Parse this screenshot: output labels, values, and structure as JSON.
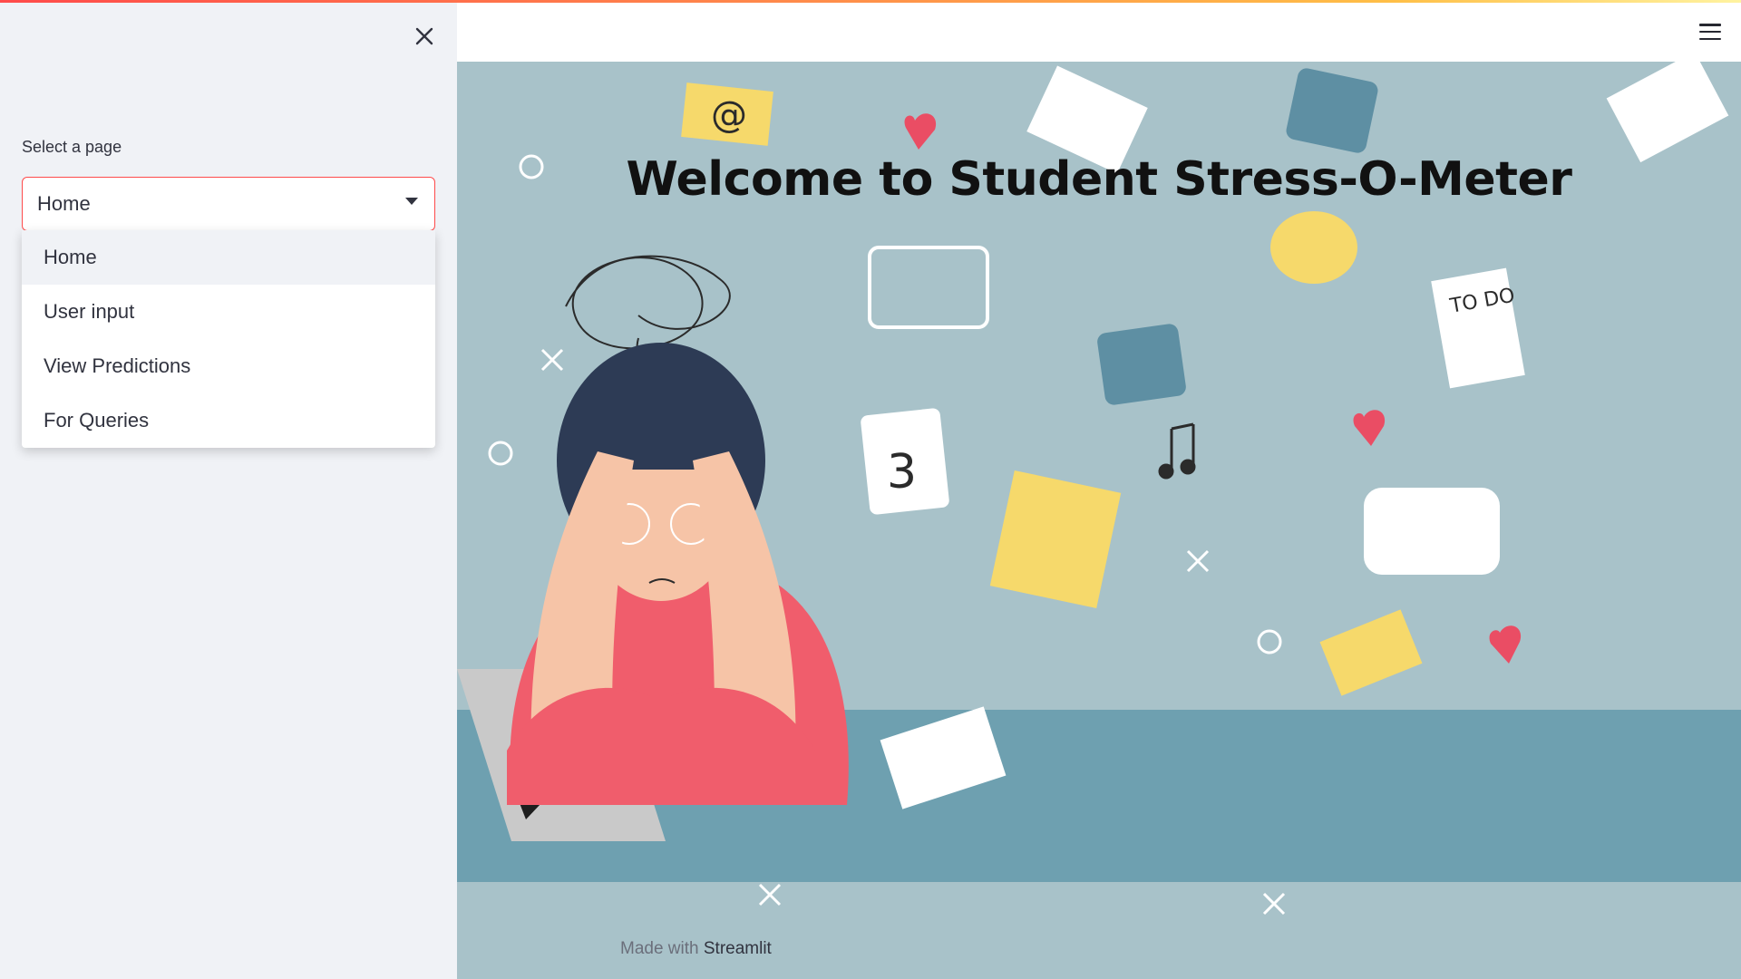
{
  "sidebar": {
    "select_label": "Select a page",
    "selected": "Home",
    "options": [
      "Home",
      "User input",
      "View Predictions",
      "For Queries"
    ]
  },
  "main": {
    "title": "Welcome to Student Stress-O-Meter",
    "footer_prefix": "Made with ",
    "footer_brand": "Streamlit"
  },
  "icons": {
    "close": "close-icon",
    "dropdown": "chevron-down-icon",
    "menu": "hamburger-menu-icon"
  },
  "colors": {
    "accent": "#ff4b4b",
    "sidebar_bg": "#f0f2f6",
    "hero_bg": "#a8c2c9",
    "desk": "#6ea0b0"
  }
}
